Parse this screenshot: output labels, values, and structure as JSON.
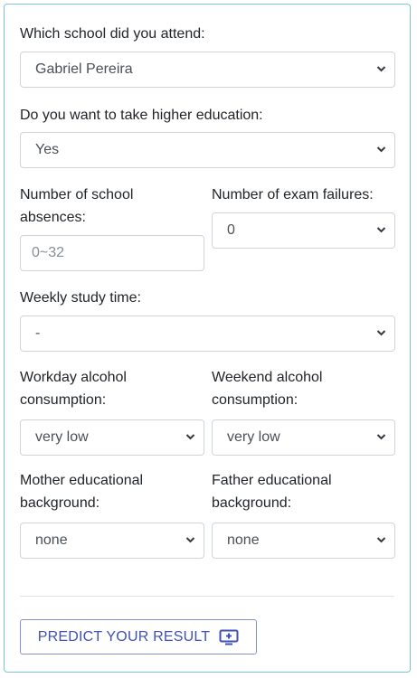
{
  "form": {
    "school": {
      "label": "Which school did you attend:",
      "value": "Gabriel Pereira"
    },
    "higher_education": {
      "label": "Do you want to take higher education:",
      "value": "Yes"
    },
    "absences": {
      "label_line1": "Number of school",
      "label_line2": "absences:",
      "placeholder": "0~32"
    },
    "failures": {
      "label": "Number of exam failures:",
      "value": "0"
    },
    "study_time": {
      "label": "Weekly study time:",
      "value": "-"
    },
    "workday_alcohol": {
      "label_line1": "Workday alcohol",
      "label_line2": "consumption:",
      "value": "very low"
    },
    "weekend_alcohol": {
      "label_line1": "Weekend alcohol",
      "label_line2": "consumption:",
      "value": "very low"
    },
    "mother_edu": {
      "label_line1": "Mother educational",
      "label_line2": "background:",
      "value": "none"
    },
    "father_edu": {
      "label_line1": "Father educational",
      "label_line2": "background:",
      "value": "none"
    },
    "predict_button": {
      "label": "PREDICT YOUR RESULT",
      "icon": "monitor-plus-icon"
    }
  },
  "colors": {
    "card_border": "#7fc4d6",
    "button_text": "#3f51b5",
    "button_border": "#8a8fd0"
  }
}
